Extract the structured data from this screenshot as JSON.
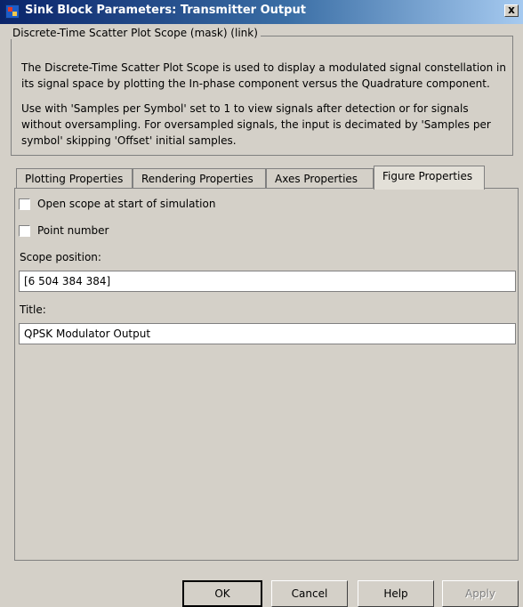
{
  "window": {
    "title": "Sink Block Parameters: Transmitter Output",
    "close_label": "x"
  },
  "group": {
    "legend": "Discrete-Time Scatter Plot Scope (mask) (link)",
    "paragraph1": "The Discrete-Time Scatter Plot Scope is used to display a modulated signal constellation in its signal space by plotting the In-phase component versus the Quadrature component.",
    "paragraph2": "Use with 'Samples per Symbol' set to 1 to view signals after detection or for signals without oversampling.  For oversampled signals, the input is decimated by 'Samples per symbol' skipping 'Offset' initial samples."
  },
  "tabs": [
    {
      "label": "Plotting Properties",
      "active": false
    },
    {
      "label": "Rendering Properties",
      "active": false
    },
    {
      "label": "Axes Properties",
      "active": false
    },
    {
      "label": "Figure Properties",
      "active": true
    }
  ],
  "figure_properties": {
    "open_scope_label": "Open scope at start of simulation",
    "open_scope_checked": false,
    "point_number_label": "Point number",
    "point_number_checked": false,
    "scope_position_label": "Scope position:",
    "scope_position_value": "[6 504 384 384]",
    "title_label": "Title:",
    "title_value": "QPSK Modulator Output"
  },
  "buttons": {
    "ok": "OK",
    "cancel": "Cancel",
    "help": "Help",
    "apply": "Apply"
  }
}
